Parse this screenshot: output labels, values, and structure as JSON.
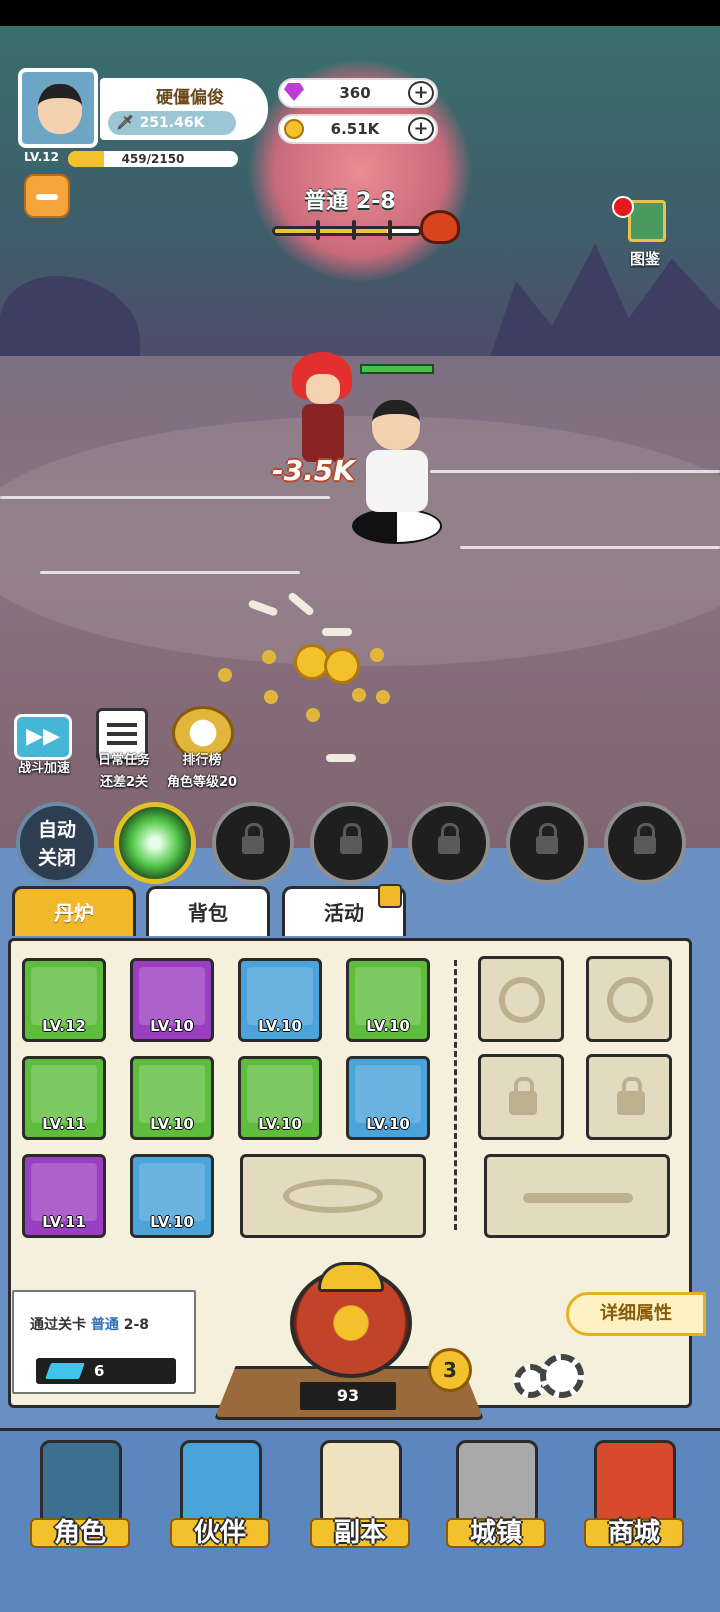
{
  "player": {
    "name": "硬僵偏俊",
    "power": "251.46K",
    "level": "LV.12",
    "exp_text": "459/2150",
    "exp_fraction": 0.213
  },
  "resources": {
    "gems": "360",
    "gold": "6.51K",
    "plus": "+"
  },
  "stage": {
    "title": "普通 2-8",
    "progress_fraction": 0.78
  },
  "handbook": {
    "label": "图鉴"
  },
  "battle": {
    "damage": "-3.5K"
  },
  "side_buttons": {
    "speed": {
      "label": "战斗加速",
      "glyph": "▶▶"
    },
    "daily": {
      "label": "日常任务",
      "sub": "还差2关"
    },
    "rank": {
      "label": "排行榜",
      "sub": "角色等级20"
    }
  },
  "skills": {
    "auto_label_line1": "自动",
    "auto_label_line2": "关闭"
  },
  "tabs": [
    "丹炉",
    "背包",
    "活动"
  ],
  "inventory": [
    {
      "level": "LV.12",
      "rarity": "green"
    },
    {
      "level": "LV.10",
      "rarity": "purple"
    },
    {
      "level": "LV.10",
      "rarity": "blue"
    },
    {
      "level": "LV.10",
      "rarity": "green"
    },
    {
      "level": "LV.11",
      "rarity": "green"
    },
    {
      "level": "LV.10",
      "rarity": "green"
    },
    {
      "level": "LV.10",
      "rarity": "green"
    },
    {
      "level": "LV.10",
      "rarity": "blue"
    },
    {
      "level": "LV.11",
      "rarity": "purple"
    },
    {
      "level": "LV.10",
      "rarity": "blue"
    }
  ],
  "stage_info": {
    "prefix": "通过关卡",
    "highlight": "普通",
    "stage": "2-8",
    "tickets": "6"
  },
  "furnace": {
    "count": "93",
    "level": "3"
  },
  "detail_button": "详细属性",
  "nav": [
    "角色",
    "伙伴",
    "副本",
    "城镇",
    "商城"
  ],
  "colors": {
    "gold": "#f3c12b",
    "rarity_green": "#5fbd3e",
    "rarity_purple": "#9a3fc1",
    "rarity_blue": "#4aa3d9",
    "panel_blue": "#6a8fc2"
  }
}
